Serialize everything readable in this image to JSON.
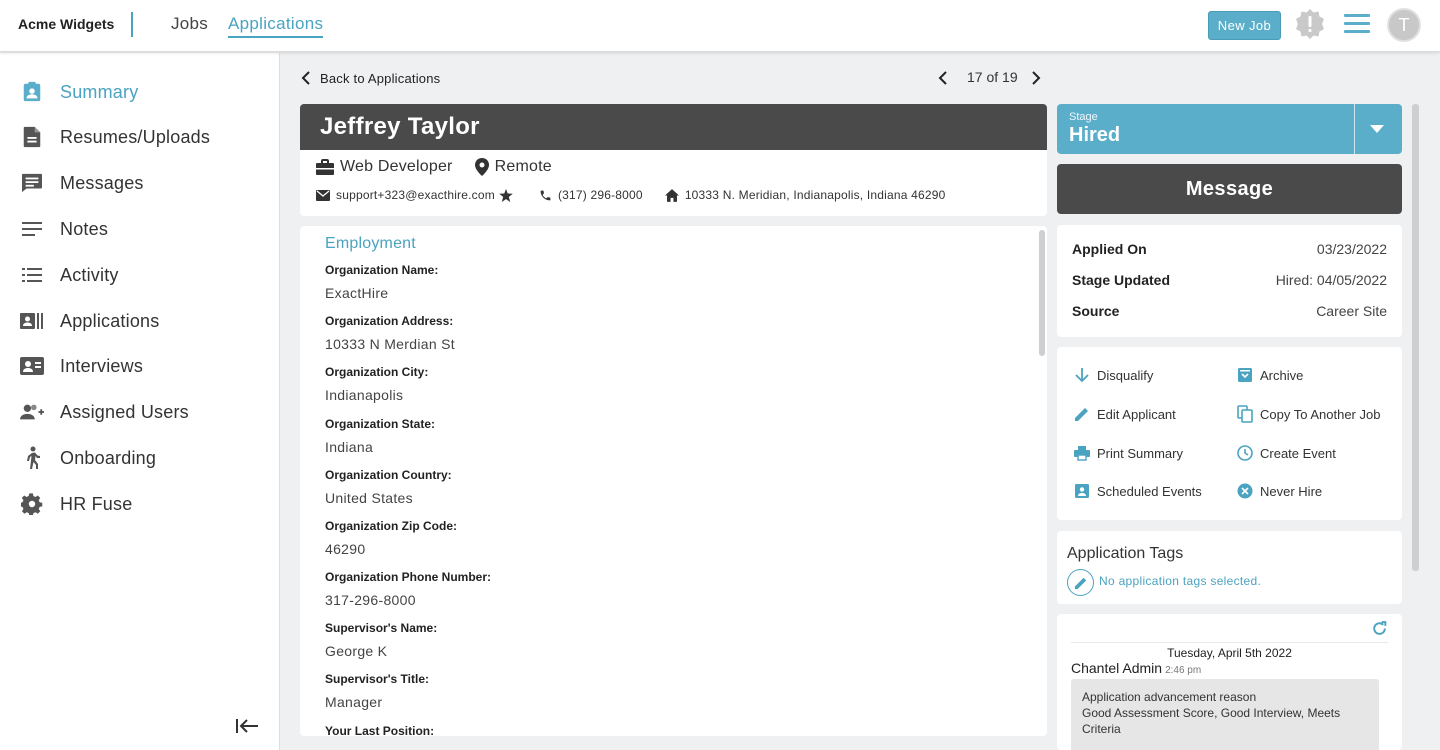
{
  "topbar": {
    "brand": "Acme Widgets",
    "nav": [
      {
        "label": "Jobs"
      },
      {
        "label": "Applications"
      }
    ],
    "new_job_label": "New Job",
    "avatar_initial": "T"
  },
  "sidebar": {
    "items": [
      {
        "label": "Summary",
        "icon": "clipboard-user-icon"
      },
      {
        "label": "Resumes/Uploads",
        "icon": "document-icon"
      },
      {
        "label": "Messages",
        "icon": "message-icon"
      },
      {
        "label": "Notes",
        "icon": "notes-icon"
      },
      {
        "label": "Activity",
        "icon": "list-icon"
      },
      {
        "label": "Applications",
        "icon": "applications-icon"
      },
      {
        "label": "Interviews",
        "icon": "interview-icon"
      },
      {
        "label": "Assigned Users",
        "icon": "add-users-icon"
      },
      {
        "label": "Onboarding",
        "icon": "walking-icon"
      },
      {
        "label": "HR Fuse",
        "icon": "gear-icon"
      }
    ]
  },
  "nav": {
    "back_label": "Back to Applications",
    "pager_text": "17 of 19"
  },
  "applicant": {
    "name": "Jeffrey Taylor",
    "job": "Web Developer",
    "location": "Remote",
    "email": "support+323@exacthire.com",
    "phone": "(317) 296-8000",
    "address": "10333 N. Meridian, Indianapolis, Indiana 46290"
  },
  "employment": {
    "title": "Employment",
    "fields": [
      {
        "key": "Organization Name:",
        "value": "ExactHire"
      },
      {
        "key": "Organization Address:",
        "value": "10333 N Merdian St"
      },
      {
        "key": "Organization City:",
        "value": "Indianapolis"
      },
      {
        "key": "Organization State:",
        "value": "Indiana"
      },
      {
        "key": "Organization Country:",
        "value": "United States"
      },
      {
        "key": "Organization Zip Code:",
        "value": "46290"
      },
      {
        "key": "Organization Phone Number:",
        "value": "317-296-8000"
      },
      {
        "key": "Supervisor's Name:",
        "value": "George K"
      },
      {
        "key": "Supervisor's Title:",
        "value": "Manager"
      },
      {
        "key": "Your Last Position:",
        "value": ""
      }
    ]
  },
  "stage": {
    "caption": "Stage",
    "value": "Hired"
  },
  "message_label": "Message",
  "info": [
    {
      "key": "Applied On",
      "value": "03/23/2022"
    },
    {
      "key": "Stage Updated",
      "value": "Hired: 04/05/2022"
    },
    {
      "key": "Source",
      "value": "Career Site"
    }
  ],
  "actions": [
    {
      "label": "Disqualify",
      "icon": "arrow-down-icon"
    },
    {
      "label": "Archive",
      "icon": "archive-icon"
    },
    {
      "label": "Edit Applicant",
      "icon": "pencil-icon"
    },
    {
      "label": "Copy To Another Job",
      "icon": "copy-icon"
    },
    {
      "label": "Print Summary",
      "icon": "printer-icon"
    },
    {
      "label": "Create Event",
      "icon": "clock-icon"
    },
    {
      "label": "Scheduled Events",
      "icon": "calendar-user-icon"
    },
    {
      "label": "Never Hire",
      "icon": "close-circle-icon"
    }
  ],
  "tags": {
    "title": "Application Tags",
    "empty_text": "No application tags selected."
  },
  "activity": {
    "date": "Tuesday, April 5th 2022",
    "user": "Chantel Admin",
    "time": "2:46 pm",
    "reason_title": "Application advancement reason",
    "reason_text": "Good Assessment Score, Good Interview, Meets Criteria"
  },
  "colors": {
    "accent": "#4aa3c0",
    "dark": "#4a4a4a",
    "background": "#eef0f2"
  }
}
